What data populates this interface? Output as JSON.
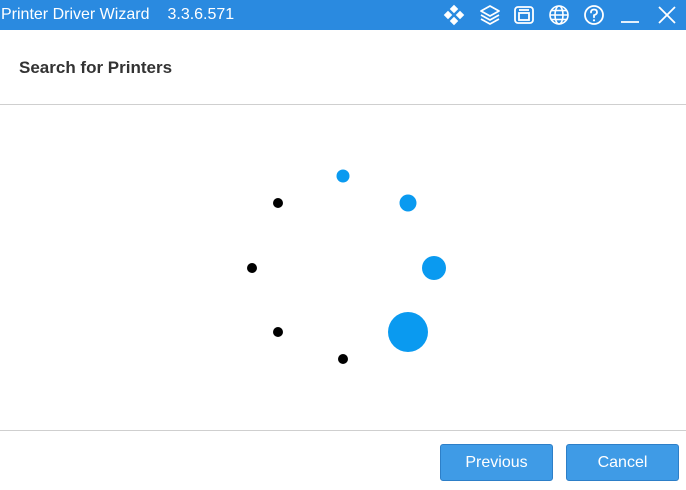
{
  "window": {
    "title": "Printer Driver Wizard",
    "version": "3.3.6.571",
    "title_icons": [
      "diamond-grid-icon",
      "layers-icon",
      "printer-icon",
      "globe-icon",
      "help-icon",
      "minimize-icon",
      "close-icon"
    ]
  },
  "header": {
    "title": "Search for Printers"
  },
  "spinner": {
    "state": "searching",
    "dot_count": 8,
    "active_color": "#0a9af0",
    "inactive_color": "#000000"
  },
  "footer": {
    "previous_label": "Previous",
    "cancel_label": "Cancel"
  },
  "colors": {
    "titlebar": "#2a8ae0",
    "button": "#3f9be6",
    "title_text": "#333333"
  }
}
